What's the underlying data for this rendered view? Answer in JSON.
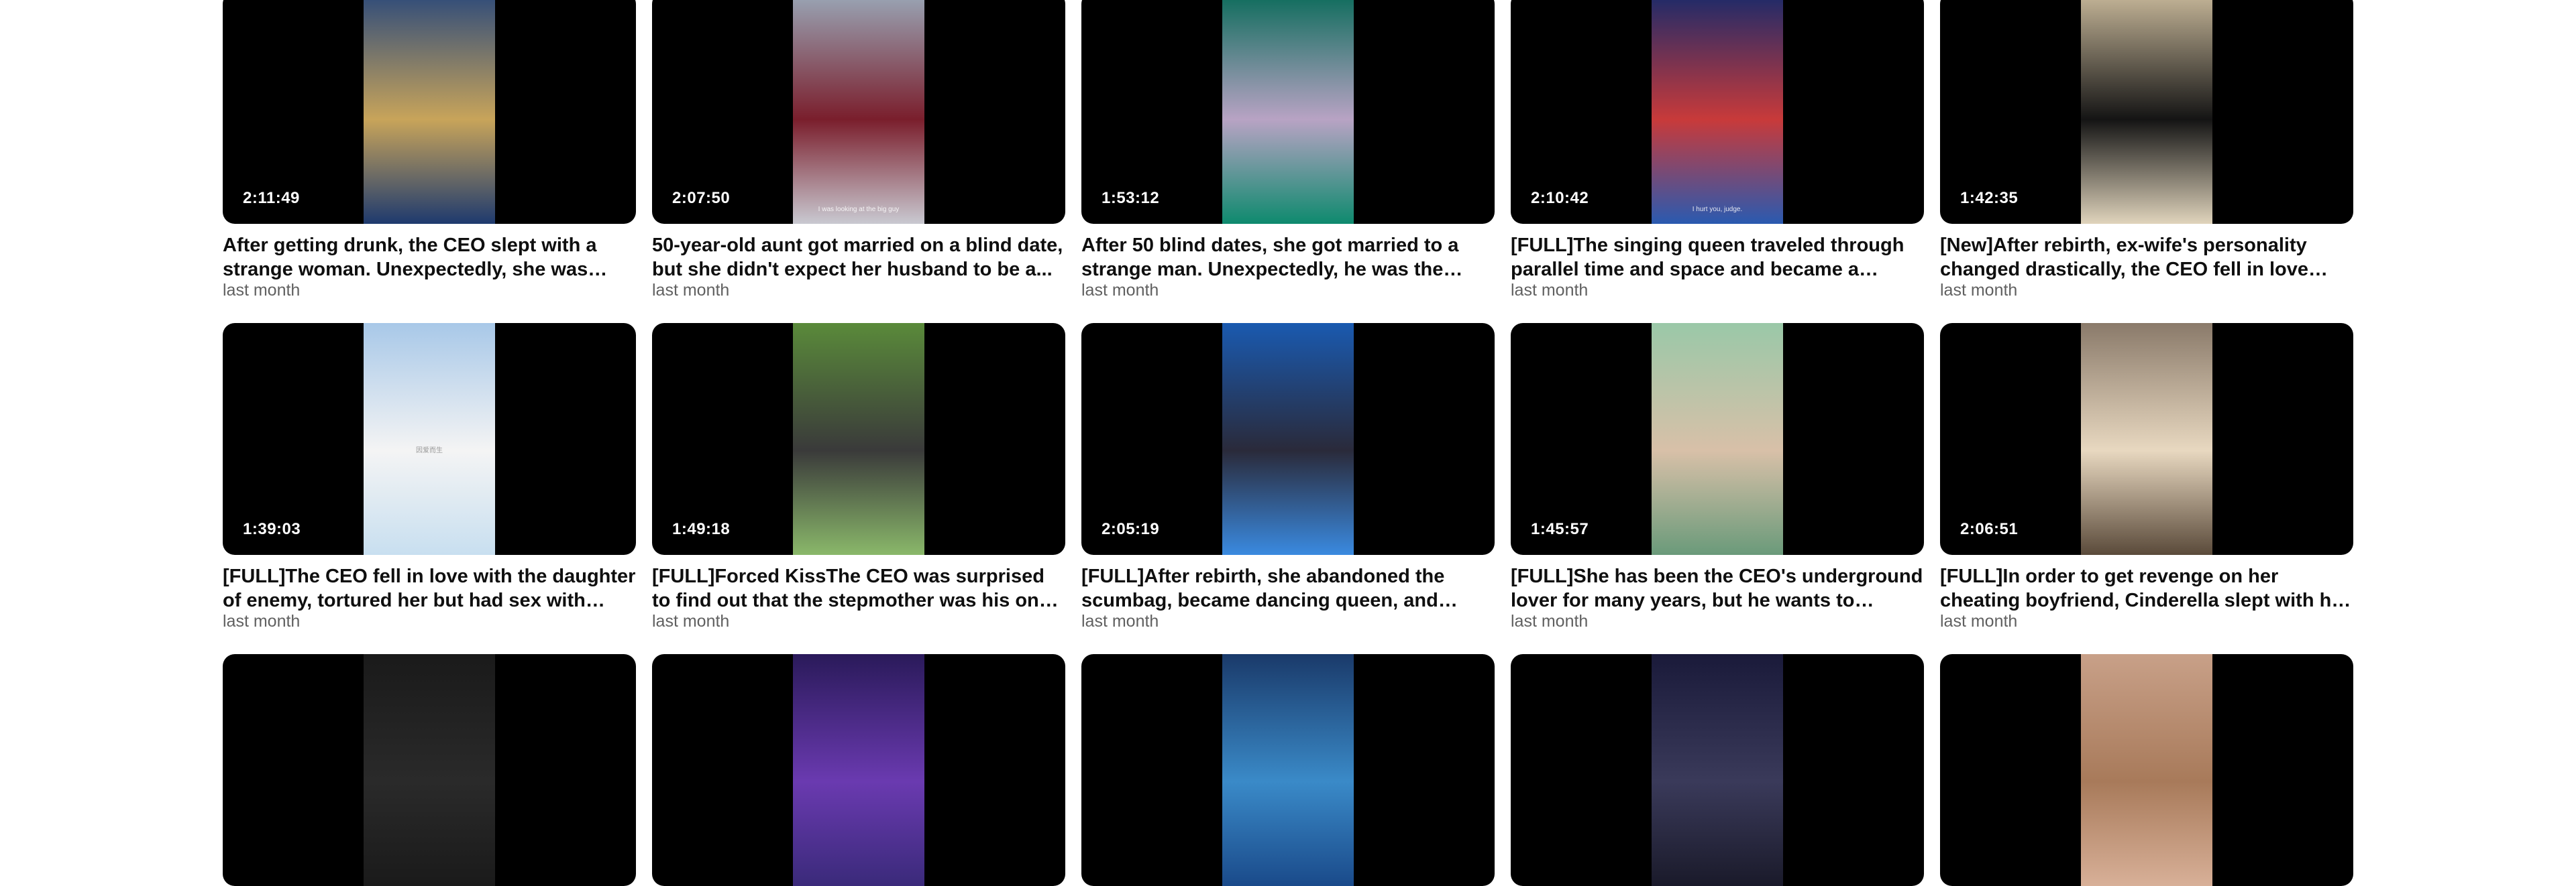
{
  "videos": [
    {
      "duration": "2:11:49",
      "title": "After getting drunk, the CEO slept with a strange woman. Unexpectedly, she was his...",
      "age": "last month",
      "thumb_colors": [
        "#2d4a7a",
        "#c8a45a",
        "#1e3a6e"
      ]
    },
    {
      "duration": "2:07:50",
      "title": "50-year-old aunt got married on a blind date, but she didn't expect her husband to be a...",
      "age": "last month",
      "caption": "I was looking at the big guy",
      "thumb_colors": [
        "#9aa8b8",
        "#7a1e2c",
        "#c9c9d1"
      ]
    },
    {
      "duration": "1:53:12",
      "title": "After 50 blind dates, she got married to a strange man. Unexpectedly, he was the richest...",
      "age": "last month",
      "thumb_colors": [
        "#0b6b5a",
        "#b8a3c4",
        "#0e8a6e"
      ]
    },
    {
      "duration": "2:10:42",
      "title": "[FULL]The singing queen traveled through parallel time and space and became a mother...",
      "age": "last month",
      "caption": "I hurt you, judge.",
      "thumb_colors": [
        "#1a2a6a",
        "#c83a3a",
        "#2a5ab0"
      ]
    },
    {
      "duration": "1:42:35",
      "title": "[New]After rebirth, ex-wife's personality changed drastically, the CEO fell in love with...",
      "age": "last month",
      "thumb_colors": [
        "#c8b89a",
        "#141414",
        "#e0d4bc"
      ]
    },
    {
      "duration": "1:39:03",
      "title": "[FULL]The CEO fell in love with the daughter of enemy, tortured her but had sex with her...",
      "age": "last month",
      "caption": "因爱而生",
      "thumb_colors": [
        "#a8c8e8",
        "#f4f4f4",
        "#c8dff0"
      ]
    },
    {
      "duration": "1:49:18",
      "title": "[FULL]Forced KissThe CEO was surprised to find out that the stepmother was his one-night...",
      "age": "last month",
      "thumb_colors": [
        "#5a8a3a",
        "#3a3a3a",
        "#8ab86a"
      ]
    },
    {
      "duration": "2:05:19",
      "title": "[FULL]After rebirth, she abandoned the scumbag, became dancing queen, and married...",
      "age": "last month",
      "thumb_colors": [
        "#1a5ab0",
        "#2a2a3a",
        "#3a8ae0"
      ]
    },
    {
      "duration": "1:45:57",
      "title": "[FULL]She has been the CEO's underground lover for many years, but he wants to marry...",
      "age": "last month",
      "thumb_colors": [
        "#9ac8a8",
        "#d8c0a8",
        "#6a9a7a"
      ]
    },
    {
      "duration": "2:06:51",
      "title": "[FULL]In order to get revenge on her cheating boyfriend, Cinderella slept with his brother-in...",
      "age": "last month",
      "thumb_colors": [
        "#8a7a6a",
        "#e8d8c0",
        "#5a4a3a"
      ]
    },
    {
      "duration": "",
      "title": "",
      "age": "",
      "thumb_colors": [
        "#1a1a1a",
        "#2a2a2a",
        "#1a1a1a"
      ]
    },
    {
      "duration": "",
      "title": "",
      "age": "",
      "thumb_colors": [
        "#2a1a5a",
        "#6a3ab0",
        "#3a2a7a"
      ]
    },
    {
      "duration": "",
      "title": "",
      "age": "",
      "thumb_colors": [
        "#1a3a6a",
        "#3a8ac8",
        "#1a4a8a"
      ]
    },
    {
      "duration": "",
      "title": "",
      "age": "",
      "thumb_colors": [
        "#1a1a3a",
        "#3a3a5a",
        "#1a1a2a"
      ]
    },
    {
      "duration": "",
      "title": "",
      "age": "",
      "thumb_colors": [
        "#c8a088",
        "#a87a5a",
        "#d8b098"
      ]
    }
  ]
}
